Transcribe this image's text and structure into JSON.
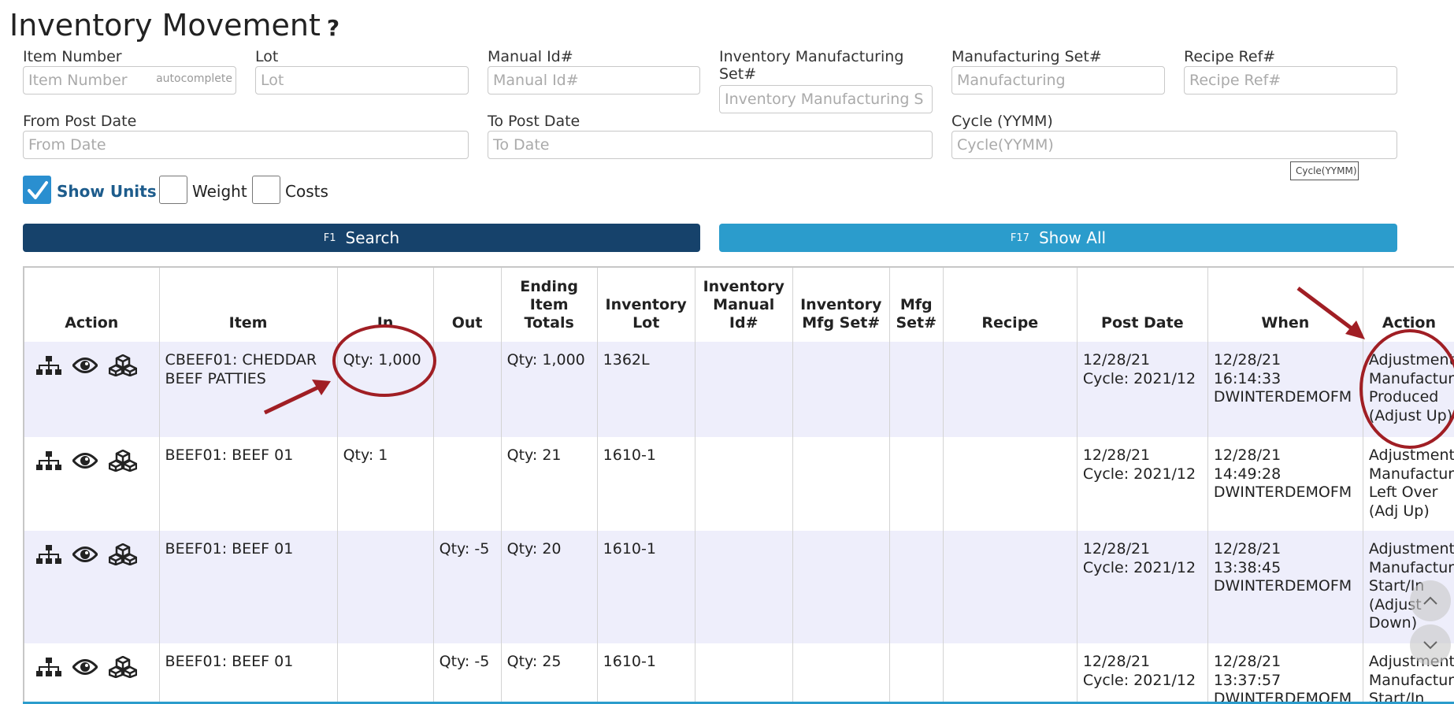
{
  "page": {
    "title": "Inventory Movement",
    "help": "?"
  },
  "filters": {
    "item_number": {
      "label": "Item Number",
      "placeholder": "Item Number",
      "hint": "autocomplete"
    },
    "lot": {
      "label": "Lot",
      "placeholder": "Lot"
    },
    "manual_id": {
      "label": "Manual Id#",
      "placeholder": "Manual Id#"
    },
    "inv_mfg_set": {
      "label_line1": "Inventory Manufacturing",
      "label_line2": "Set#",
      "placeholder": "Inventory Manufacturing S"
    },
    "mfg_set": {
      "label": "Manufacturing Set#",
      "placeholder": "Manufacturing"
    },
    "recipe_ref": {
      "label": "Recipe Ref#",
      "placeholder": "Recipe Ref#"
    },
    "from_post_date": {
      "label": "From Post Date",
      "placeholder": "From Date"
    },
    "to_post_date": {
      "label": "To Post Date",
      "placeholder": "To Date"
    },
    "cycle": {
      "label": "Cycle (YYMM)",
      "placeholder": "Cycle(YYMM)",
      "tooltip": "Cycle(YYMM)"
    }
  },
  "options": {
    "show_units": {
      "label": "Show Units",
      "checked": true
    },
    "weight": {
      "label": "Weight",
      "checked": false
    },
    "costs": {
      "label": "Costs",
      "checked": false
    }
  },
  "buttons": {
    "search": {
      "key": "F1",
      "label": "Search"
    },
    "show_all": {
      "key": "F17",
      "label": "Show All"
    }
  },
  "table": {
    "headers": {
      "action": "Action",
      "item": "Item",
      "in": "In",
      "out": "Out",
      "ending1": "Ending",
      "ending2": "Item",
      "ending3": "Totals",
      "invlot1": "Inventory",
      "invlot2": "Lot",
      "invman1": "Inventory",
      "invman2": "Manual",
      "invman3": "Id#",
      "invmfg1": "Inventory",
      "invmfg2": "Mfg Set#",
      "mfg1": "Mfg",
      "mfg2": "Set#",
      "recipe": "Recipe",
      "post_date": "Post Date",
      "when": "When",
      "action2": "Action"
    },
    "rows": [
      {
        "item": "CBEEF01: CHEDDAR BEEF PATTIES",
        "in": "Qty: 1,000",
        "out": "",
        "ending": "Qty: 1,000",
        "lot": "1362L",
        "post_date": "12/28/21",
        "cycle": "Cycle: 2021/12",
        "when_date": "12/28/21",
        "when_time": "16:14:33",
        "when_user": "DWINTERDEMOFM",
        "action": [
          "Adjustment",
          "Manufactur",
          "Produced",
          "(Adjust Up)"
        ]
      },
      {
        "item": "BEEF01: BEEF 01",
        "in": "Qty: 1",
        "out": "",
        "ending": "Qty: 21",
        "lot": "1610-1",
        "post_date": "12/28/21",
        "cycle": "Cycle: 2021/12",
        "when_date": "12/28/21",
        "when_time": "14:49:28",
        "when_user": "DWINTERDEMOFM",
        "action": [
          "Adjustment",
          "Manufactur",
          "Left Over",
          "(Adj Up)"
        ]
      },
      {
        "item": "BEEF01: BEEF 01",
        "in": "",
        "out": "Qty: -5",
        "ending": "Qty: 20",
        "lot": "1610-1",
        "post_date": "12/28/21",
        "cycle": "Cycle: 2021/12",
        "when_date": "12/28/21",
        "when_time": "13:38:45",
        "when_user": "DWINTERDEMOFM",
        "action": [
          "Adjustment",
          "Manufactur",
          "Start/In",
          "(Adjust",
          "Down)"
        ]
      },
      {
        "item": "BEEF01: BEEF 01",
        "in": "",
        "out": "Qty: -5",
        "ending": "Qty: 25",
        "lot": "1610-1",
        "post_date": "12/28/21",
        "cycle": "Cycle: 2021/12",
        "when_date": "12/28/21",
        "when_time": "13:37:57",
        "when_user": "DWINTERDEMOFM",
        "action": [
          "Adjustment",
          "Manufactur",
          "Start/In"
        ]
      }
    ]
  },
  "colors": {
    "primary": "#16426b",
    "secondary": "#2b9ccc",
    "accent": "#2a8fd0",
    "annotation": "#a01e24",
    "row_alt": "#eeeefb"
  }
}
